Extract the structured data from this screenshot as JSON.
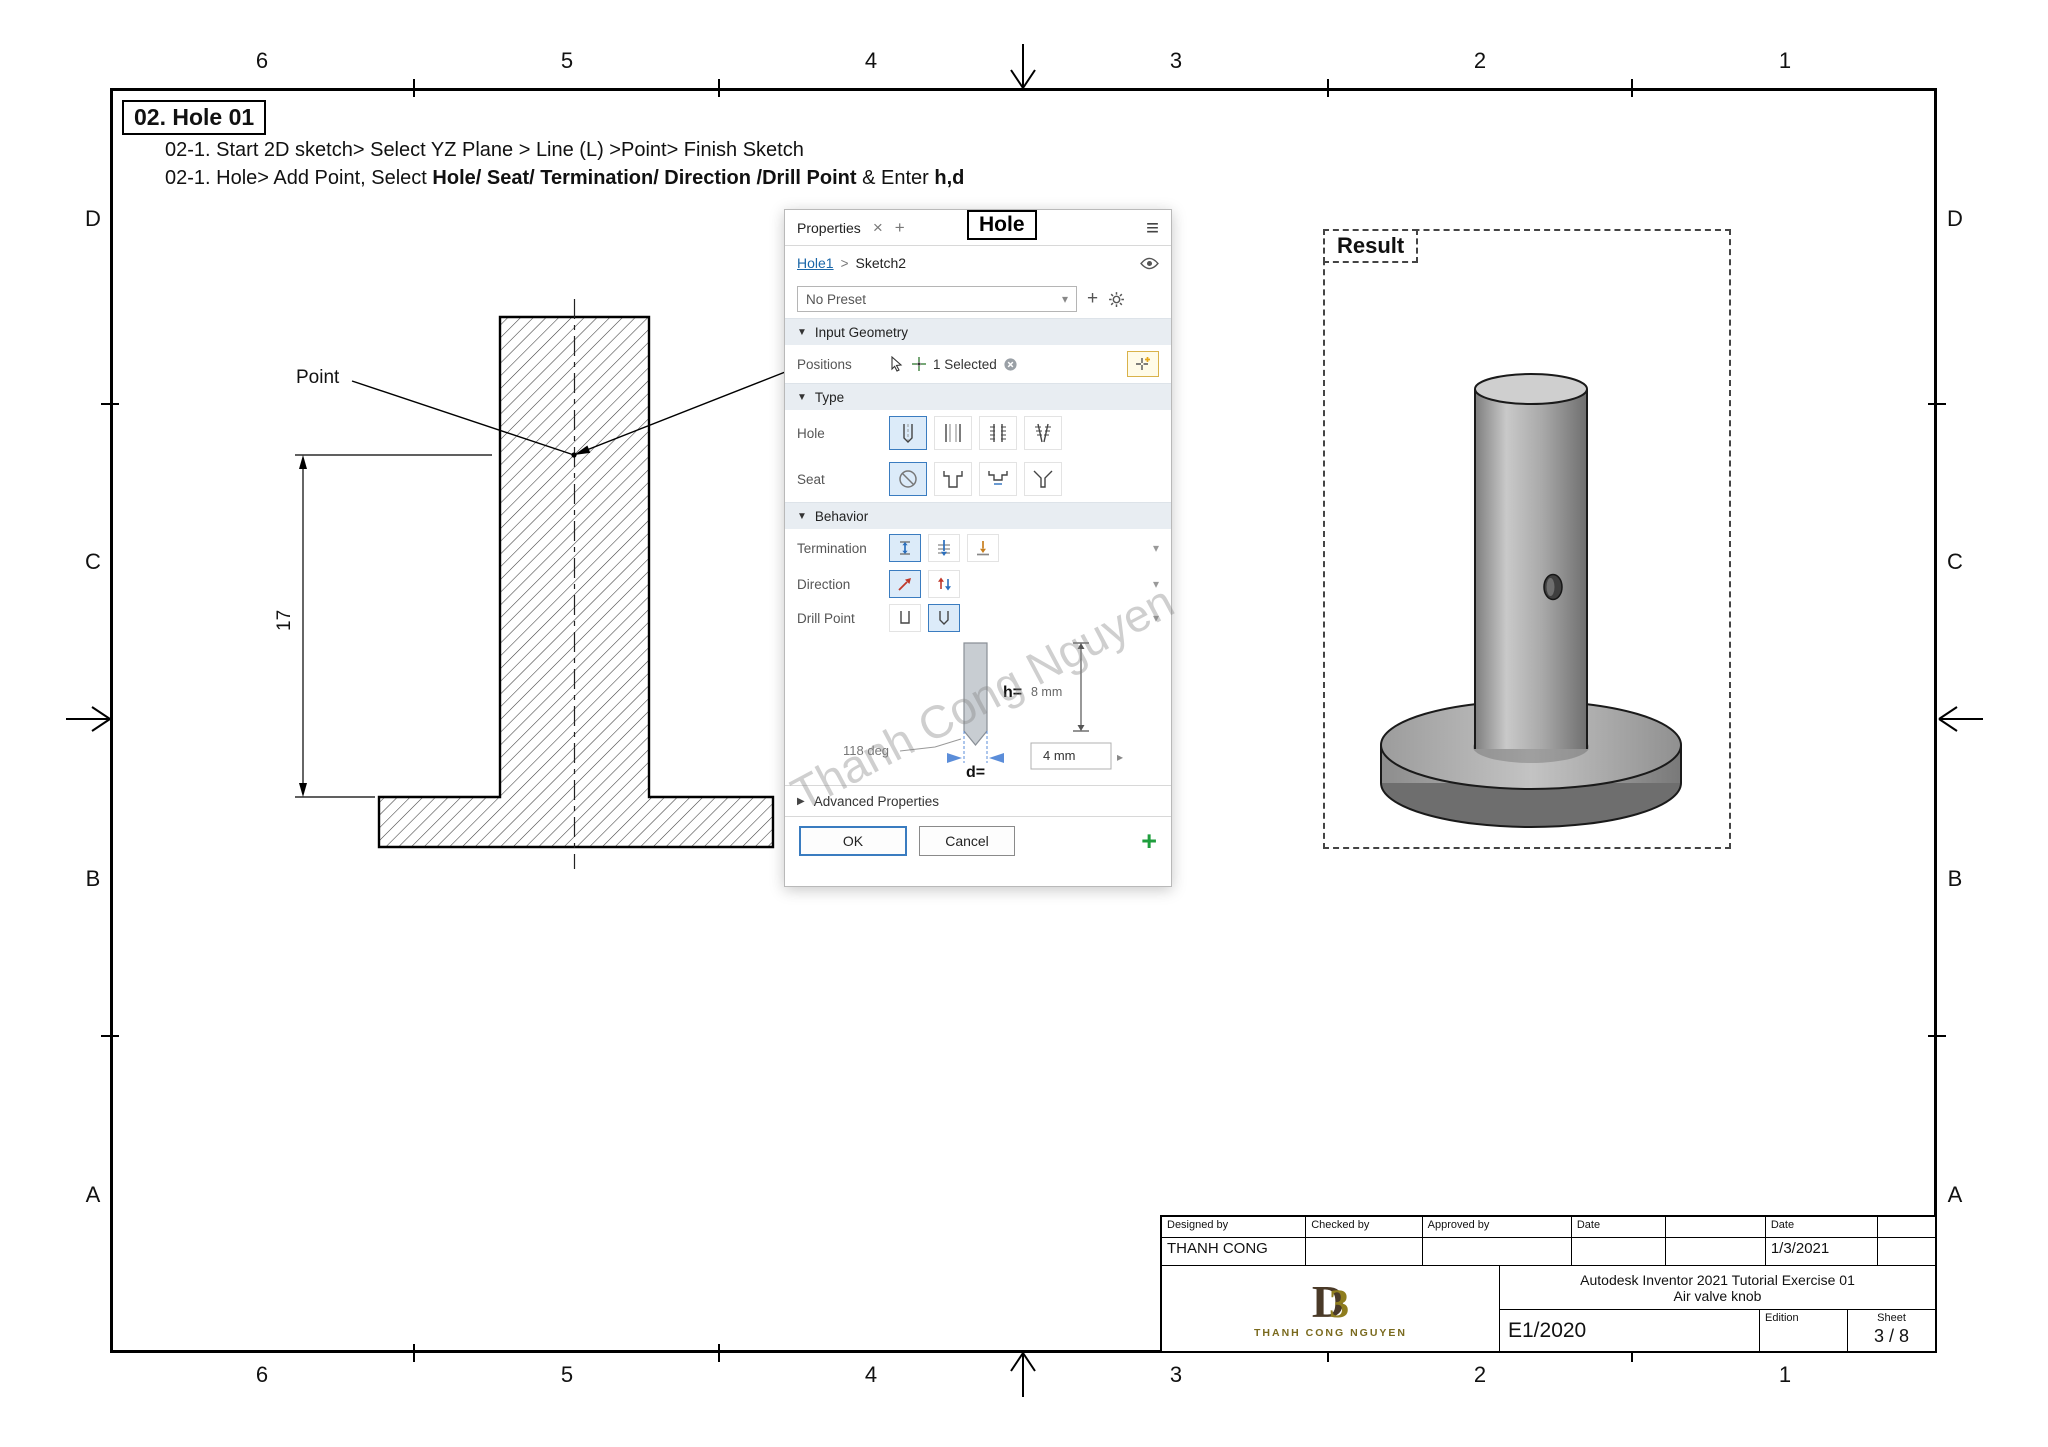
{
  "colors": {
    "accent_blue": "#3a7cc0",
    "selected_bg": "#dcebf9",
    "green": "#1f9e3d",
    "link_blue": "#1a66a8",
    "watermark": "rgba(130,130,130,0.38)"
  },
  "sheet": {
    "zones_top": [
      "6",
      "5",
      "4",
      "3",
      "2",
      "1"
    ],
    "zones_bottom": [
      "6",
      "5",
      "4",
      "3",
      "2",
      "1"
    ],
    "zones_left": [
      "D",
      "C",
      "B",
      "A"
    ],
    "zones_right": [
      "D",
      "C",
      "B",
      "A"
    ]
  },
  "header": {
    "title": "02. Hole 01",
    "instr1": "02-1. Start 2D sketch> Select YZ Plane > Line (L) >Point> Finish Sketch",
    "instr2_a": "02-1. Hole> Add Point, Select ",
    "instr2_b": "Hole/ Seat/ Termination/ Direction /Drill Point",
    "instr2_c": " & Enter ",
    "instr2_d": "h,d"
  },
  "drawing": {
    "point_label": "Point",
    "dim_17": "17"
  },
  "panel": {
    "tab": "Properties",
    "callout": "Hole",
    "breadcrumb": {
      "feature": "Hole1",
      "sep": ">",
      "sketch": "Sketch2"
    },
    "preset": "No Preset",
    "icons": {
      "close": "×",
      "add_tab": "+",
      "menu": "≡",
      "caret": "▾",
      "plus": "+",
      "expand": "▼",
      "collapse": "▶",
      "spinner": "▸",
      "green_plus": "+"
    },
    "sections": {
      "input_geometry": "Input Geometry",
      "type": "Type",
      "behavior": "Behavior",
      "advanced": "Advanced Properties"
    },
    "positions": {
      "label": "Positions",
      "value": "1 Selected"
    },
    "type_rows": {
      "hole": "Hole",
      "seat": "Seat"
    },
    "behavior_rows": {
      "termination": "Termination",
      "direction": "Direction",
      "drill_point": "Drill Point"
    },
    "diagram": {
      "angle": "118 deg",
      "h_label": "h=",
      "h_value": "8 mm",
      "d_label": "d=",
      "d_value": "4 mm"
    },
    "buttons": {
      "ok": "OK",
      "cancel": "Cancel"
    }
  },
  "result": {
    "label": "Result"
  },
  "watermark": "Thanh Cong Nguyen",
  "title_block": {
    "designed_by_label": "Designed by",
    "designed_by_value": "THANH CONG",
    "checked_by_label": "Checked by",
    "approved_by_label": "Approved by",
    "date_label_1": "Date",
    "date_label_2": "Date",
    "date_value": "1/3/2021",
    "project_line1": "Autodesk Inventor 2021 Tutorial Exercise 01",
    "project_line2": "Air valve knob",
    "doc_code": "E1/2020",
    "edition_label": "Edition",
    "sheet_label": "Sheet",
    "sheet_value": "3 / 8",
    "logo_d": "D",
    "logo_3": "3",
    "logo_name": "THANH CONG NGUYEN"
  }
}
